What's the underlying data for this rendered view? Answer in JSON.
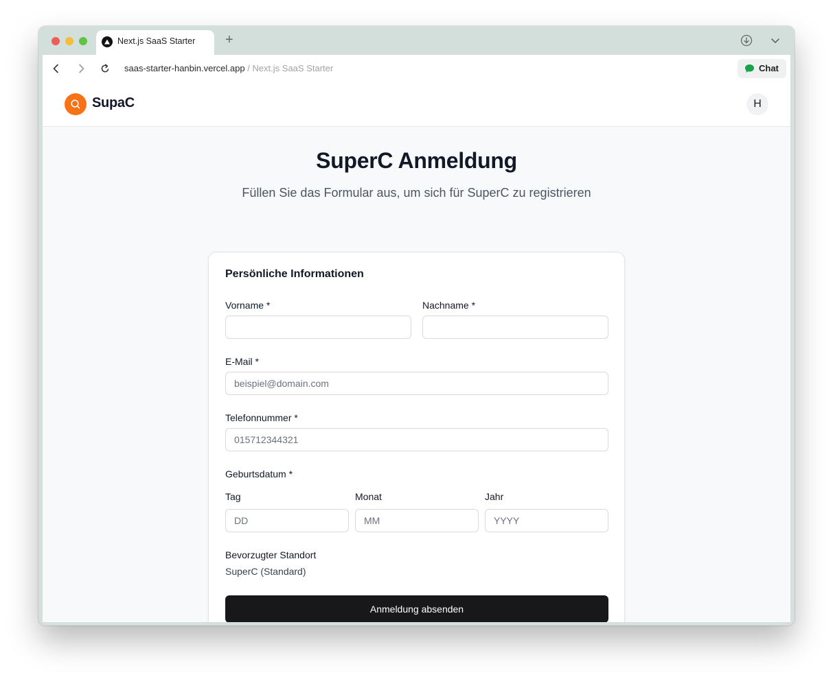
{
  "browser": {
    "tab_title": "Next.js SaaS Starter",
    "new_tab_label": "+",
    "url_host": "saas-starter-hanbin.vercel.app",
    "url_separator": " / ",
    "url_page_title": "Next.js SaaS Starter",
    "chat_label": "Chat"
  },
  "header": {
    "brand": "SupaC",
    "avatar_initial": "H"
  },
  "main": {
    "title": "SuperC Anmeldung",
    "subtitle": "Füllen Sie das Formular aus, um sich für SuperC zu registrieren"
  },
  "form": {
    "section_title": "Persönliche Informationen",
    "first_name": {
      "label": "Vorname *",
      "value": "",
      "placeholder": ""
    },
    "last_name": {
      "label": "Nachname *",
      "value": "",
      "placeholder": ""
    },
    "email": {
      "label": "E-Mail *",
      "value": "",
      "placeholder": "beispiel@domain.com"
    },
    "phone": {
      "label": "Telefonnummer *",
      "value": "",
      "placeholder": "015712344321"
    },
    "birthdate": {
      "label": "Geburtsdatum *",
      "day": {
        "label": "Tag",
        "placeholder": "DD"
      },
      "month": {
        "label": "Monat",
        "placeholder": "MM"
      },
      "year": {
        "label": "Jahr",
        "placeholder": "YYYY"
      }
    },
    "location": {
      "label": "Bevorzugter Standort",
      "value": "SuperC (Standard)"
    },
    "submit_label": "Anmeldung absenden"
  },
  "icons": {
    "tab_favicon": "triangle-logo-icon",
    "download": "download-icon",
    "tab_list": "chevron-down-icon",
    "back": "chevron-left-icon",
    "forward": "chevron-right-icon",
    "reload": "reload-icon",
    "chat": "chat-bubble-icon",
    "logo": "search-icon"
  },
  "colors": {
    "brand_orange": "#f97316",
    "submit_button": "#18181b",
    "chat_icon_green": "#16a34a",
    "page_background": "#f8f9fa"
  }
}
